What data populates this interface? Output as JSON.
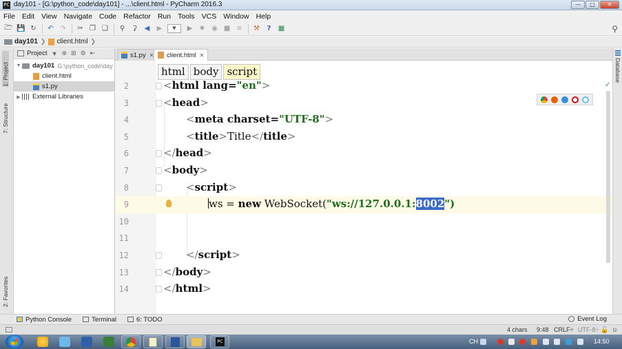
{
  "window": {
    "title": "day101 - [G:\\python_code\\day101] - ...\\client.html - PyCharm 2016.3"
  },
  "menu": [
    "File",
    "Edit",
    "View",
    "Navigate",
    "Code",
    "Refactor",
    "Run",
    "Tools",
    "VCS",
    "Window",
    "Help"
  ],
  "breadcrumb": {
    "project": "day101",
    "file": "client.html"
  },
  "left_tabs": {
    "project": "1: Project",
    "structure": "7: Structure",
    "favorites": "2: Favorites"
  },
  "project_panel": {
    "header": "Project",
    "tree": [
      {
        "label": "day101",
        "path": "G:\\python_code\\day",
        "type": "folder",
        "expanded": true
      },
      {
        "label": "client.html",
        "type": "html"
      },
      {
        "label": "s1.py",
        "type": "py",
        "selected": true
      },
      {
        "label": "External Libraries",
        "type": "library",
        "expanded": false
      }
    ]
  },
  "tabs": [
    {
      "label": "s1.py",
      "active": false
    },
    {
      "label": "client.html",
      "active": true
    }
  ],
  "editor": {
    "tag_breadcrumb": [
      "html",
      "body",
      "script"
    ],
    "line_numbers": [
      "2",
      "3",
      "4",
      "5",
      "6",
      "7",
      "8",
      "9",
      "10",
      "11",
      "12",
      "13",
      "14"
    ],
    "current_line": "9",
    "code": {
      "l2_open": "<",
      "l2_tag": "html",
      "l2_attr": " lang=",
      "l2_val": "\"en\"",
      "l2_close": ">",
      "l3": "head",
      "l4_tag": "meta",
      "l4_attr": " charset=",
      "l4_val": "\"UTF-8\"",
      "l5_tag": "title",
      "l5_text": "Title",
      "l6": "head",
      "l7": "body",
      "l8": "script",
      "l9_pre": "ws = ",
      "l9_new": "new",
      "l9_cls": " WebSocket(",
      "l9_str": "\"ws://127.0.0.1:",
      "l9_sel": "8002",
      "l9_end": "\")",
      "l12": "script",
      "l13": "body",
      "l14": "html"
    }
  },
  "right_tabs": {
    "database": "Database"
  },
  "bottom_tools": [
    "Python Console",
    "Terminal",
    "6: TODO"
  ],
  "event_log": "Event Log",
  "status": {
    "chars": "4 chars",
    "position": "9:48",
    "line_sep": "CRLF÷",
    "encoding": "UTF-8÷"
  },
  "taskbar": {
    "ime": "CH",
    "clock": "14:50"
  },
  "colors": {
    "selection": "#3a6bc8",
    "current_line": "#fdfae6",
    "string": "#1f6e1f"
  }
}
